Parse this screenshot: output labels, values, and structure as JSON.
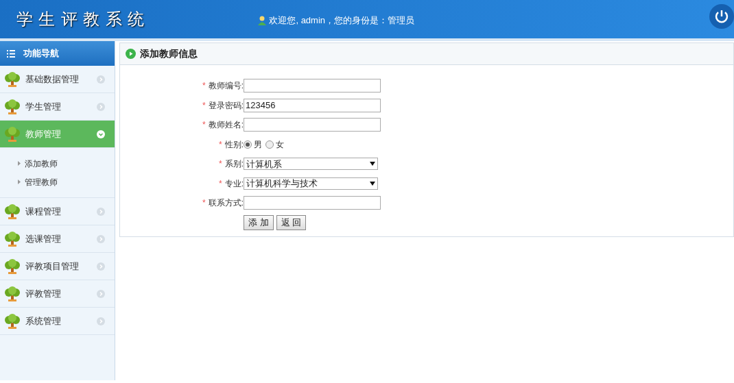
{
  "header": {
    "title": "学生评教系统",
    "welcome": "欢迎您, admin，您的身份是：管理员"
  },
  "sidebar": {
    "title": "功能导航",
    "items": [
      {
        "label": "基础数据管理",
        "expanded": false
      },
      {
        "label": "学生管理",
        "expanded": false
      },
      {
        "label": "教师管理",
        "expanded": true,
        "children": [
          {
            "label": "添加教师"
          },
          {
            "label": "管理教师"
          }
        ]
      },
      {
        "label": "课程管理",
        "expanded": false
      },
      {
        "label": "选课管理",
        "expanded": false
      },
      {
        "label": "评教项目管理",
        "expanded": false
      },
      {
        "label": "评教管理",
        "expanded": false
      },
      {
        "label": "系统管理",
        "expanded": false
      }
    ]
  },
  "panel": {
    "title": "添加教师信息",
    "fields": [
      {
        "kind": "text",
        "required_mark": "*",
        "label": "教师编号:"
      },
      {
        "kind": "text",
        "required_mark": "*",
        "label": "登录密码:",
        "value": "123456"
      },
      {
        "kind": "text",
        "required_mark": "*",
        "label": "教师姓名:"
      },
      {
        "kind": "radio",
        "required_mark": "*",
        "label": "性别:",
        "options": [
          {
            "label": "男",
            "selected": true
          },
          {
            "label": "女",
            "selected": false
          }
        ]
      },
      {
        "kind": "select",
        "required_mark": "*",
        "label": "系别:",
        "value": "计算机系"
      },
      {
        "kind": "select",
        "required_mark": "*",
        "label": "专业:",
        "value": "计算机科学与技术"
      },
      {
        "kind": "text",
        "required_mark": "*",
        "label": "联系方式:"
      }
    ],
    "buttons": [
      "添 加",
      "返 回"
    ]
  }
}
